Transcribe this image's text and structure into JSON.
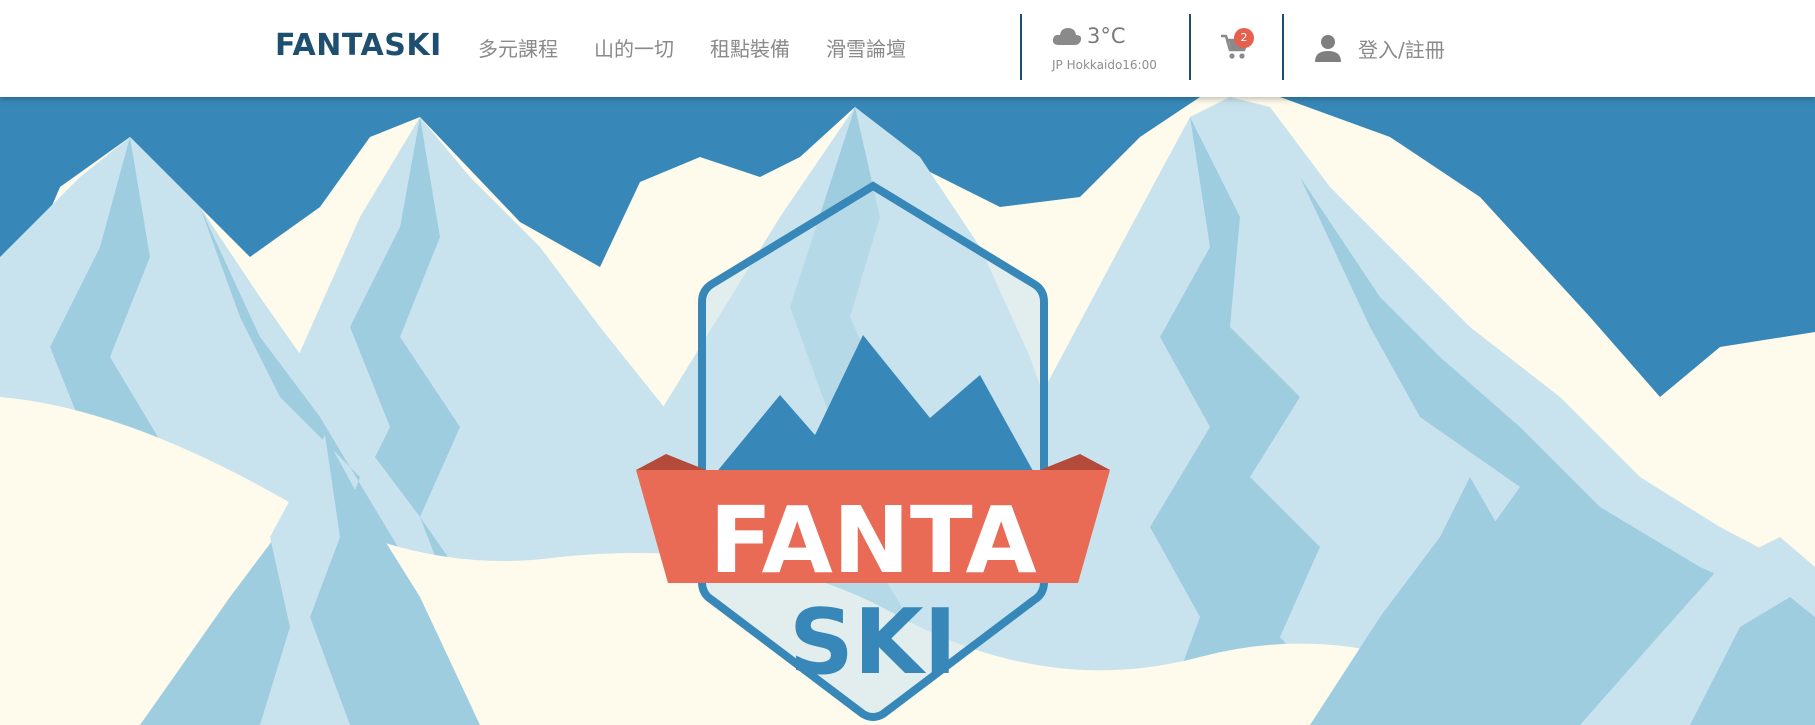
{
  "header": {
    "brand": "FANTASKI",
    "nav": [
      {
        "label": "多元課程"
      },
      {
        "label": "山的一切"
      },
      {
        "label": "租點裝備"
      },
      {
        "label": "滑雪論壇"
      }
    ],
    "weather": {
      "icon": "cloud-icon",
      "temperature": "3°C",
      "location_time": "JP Hokkaido16:00"
    },
    "cart": {
      "icon": "cart-icon",
      "count": "2"
    },
    "login": {
      "icon": "user-icon",
      "label": "登入/註冊"
    }
  },
  "hero": {
    "logo_line1": "FANTA",
    "logo_line2": "SKI"
  },
  "colors": {
    "brand_dark": "#1f4f6e",
    "sky": "#3788b8",
    "ice_light": "#c9e3ee",
    "ice_mid": "#9fcde0",
    "snow": "#fefbec",
    "ribbon": "#e96a55",
    "badge": "#e7604d"
  }
}
